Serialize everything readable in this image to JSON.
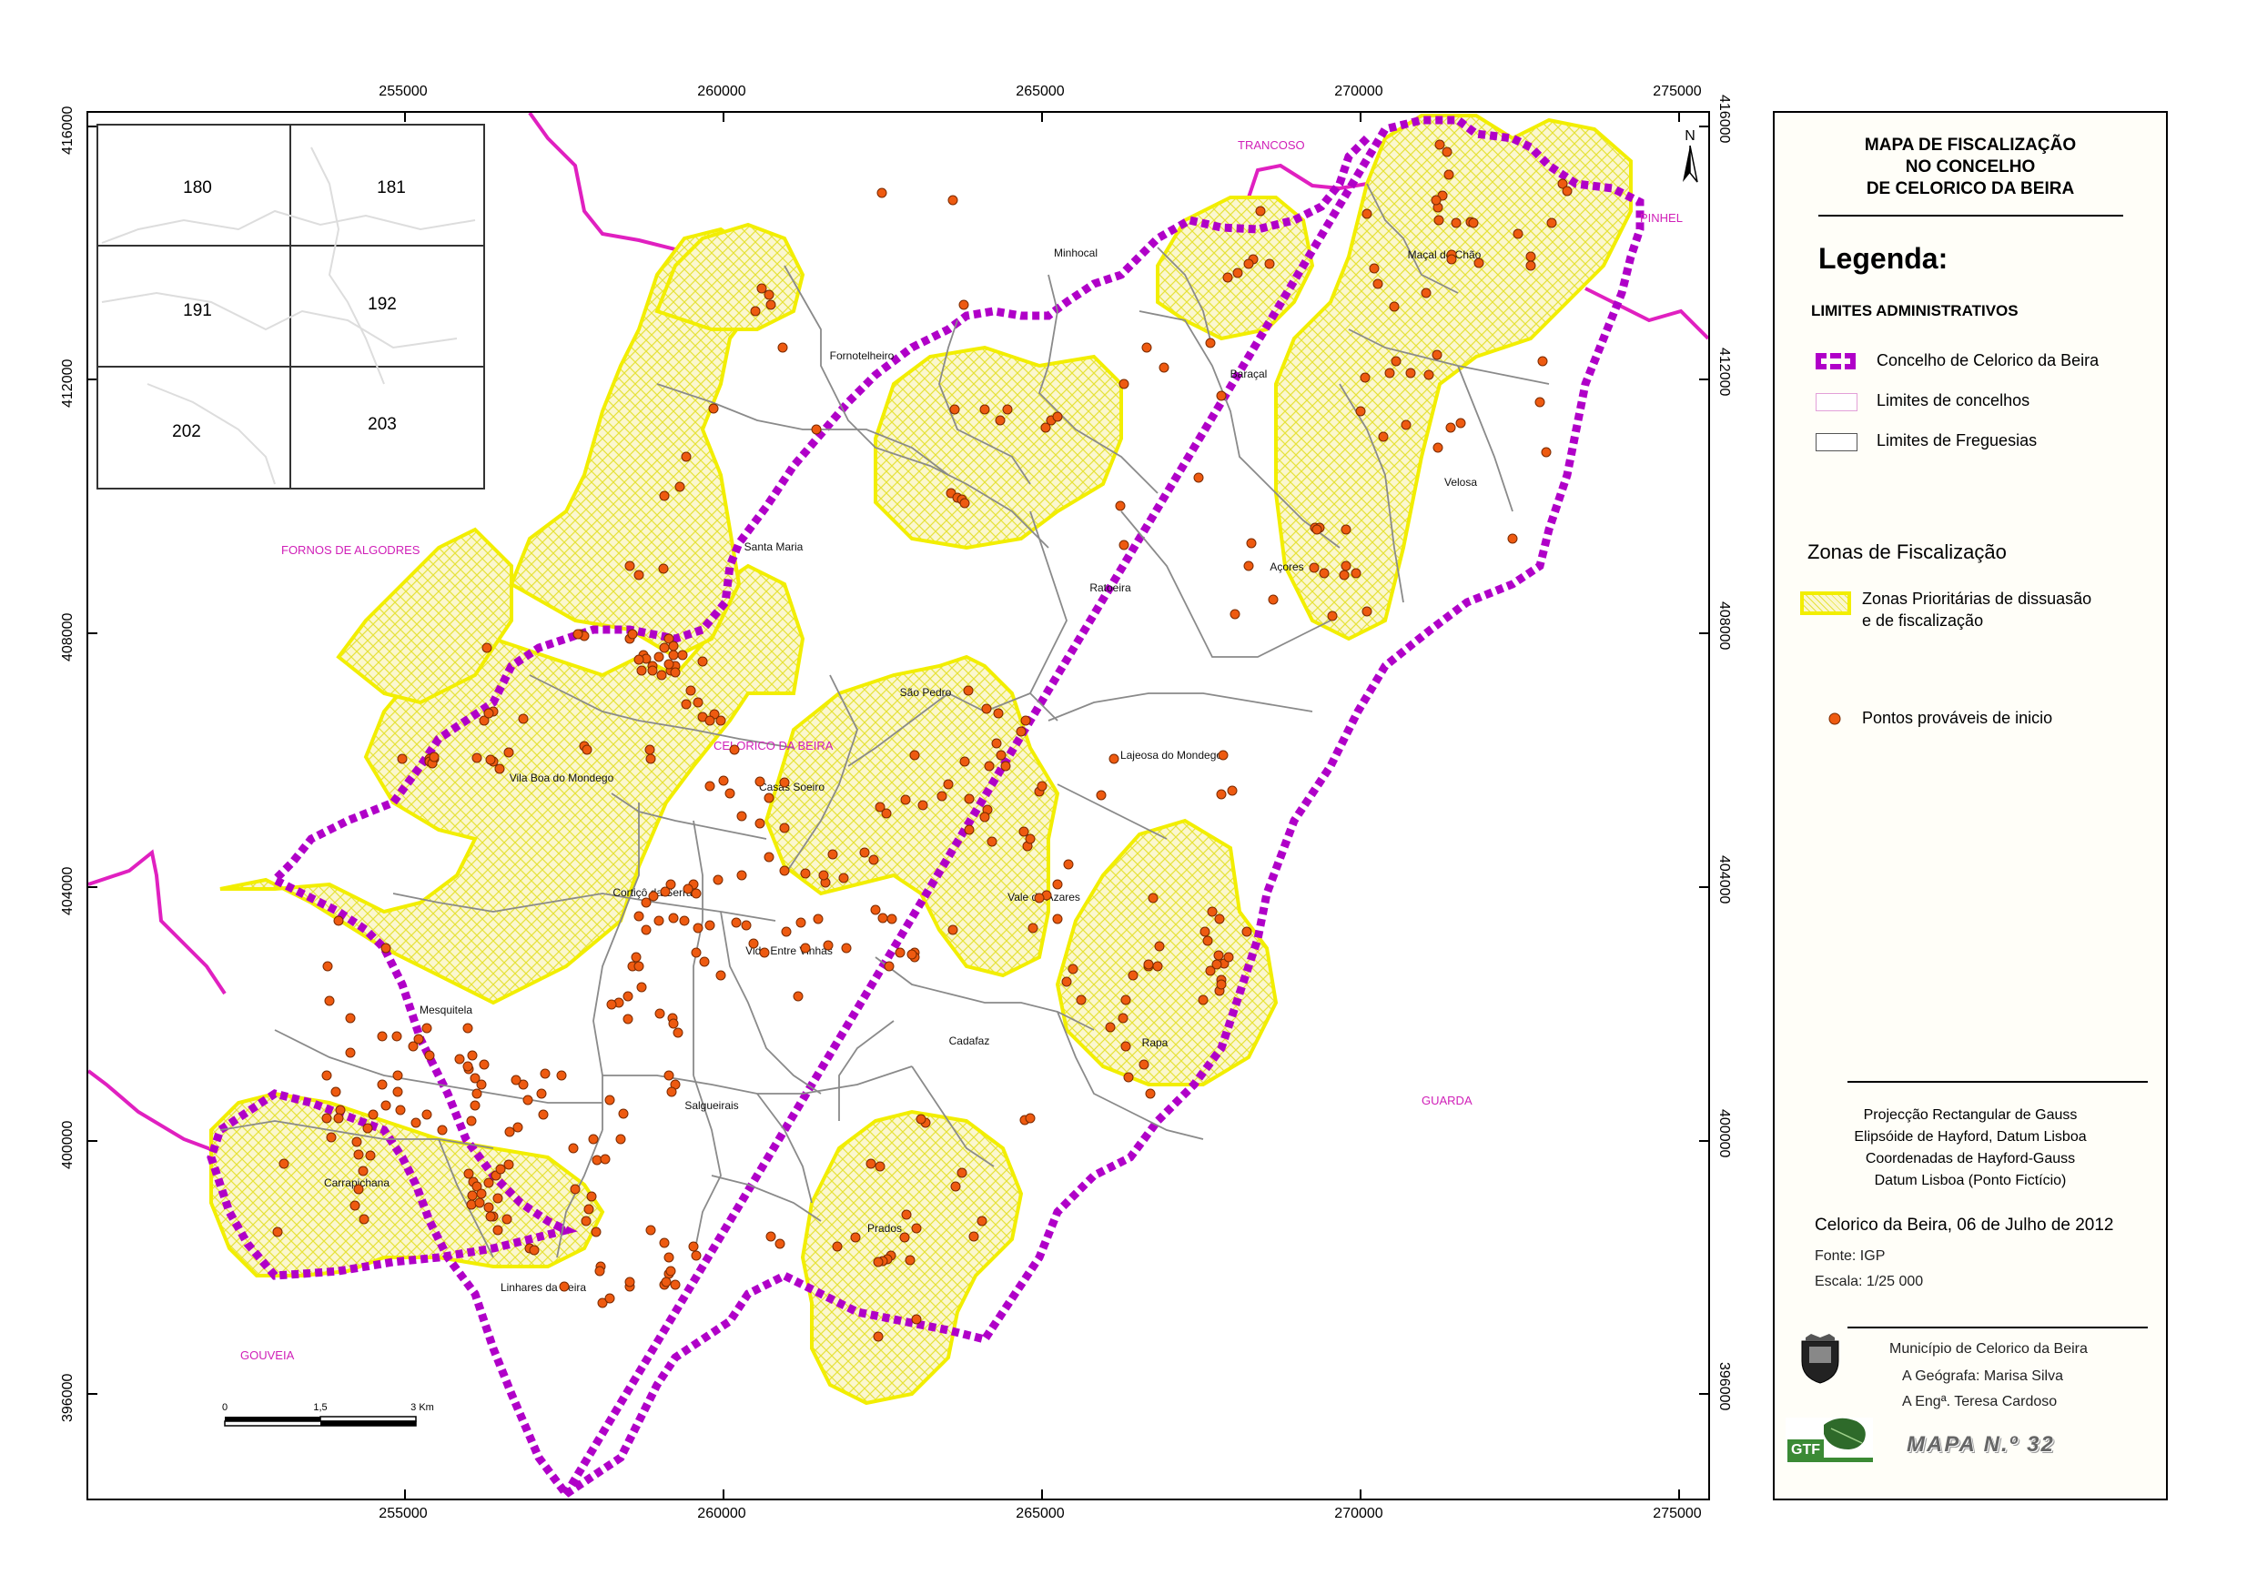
{
  "map": {
    "x_ticks": [
      "255000",
      "260000",
      "265000",
      "270000",
      "275000"
    ],
    "y_ticks": [
      "416000",
      "412000",
      "408000",
      "404000",
      "400000",
      "396000"
    ],
    "inset_sheets": [
      "180",
      "181",
      "191",
      "192",
      "202",
      "203"
    ],
    "neighbor_labels": {
      "trancoso": "TRANCOSO",
      "pinhel": "PINHEL",
      "fornos": "FORNOS DE ALGODRES",
      "celorico": "CELORICO DA BEIRA",
      "guarda": "GUARDA",
      "gouveia": "GOUVEIA"
    },
    "parishes": [
      "Minhocal",
      "Fornotelheiro",
      "Baraçal",
      "Maçal do Chão",
      "Velosa",
      "Açores",
      "Santa Maria",
      "Ratoeira",
      "São Pedro",
      "Lajeosa do Mondego",
      "Casas Soeiro",
      "Vila Boa do Mondego",
      "Cortiçô da Serra",
      "Vale de Azares",
      "Vide Entre Vinhas",
      "Mesquitela",
      "Rapa",
      "Cadafaz",
      "Salgueirais",
      "Carrapichana",
      "Prados",
      "Linhares da Beira"
    ],
    "north_label": "N",
    "scale_labels": [
      "0",
      "1,5",
      "3 Km"
    ],
    "colors": {
      "boundary": "#b000c8",
      "neighbor": "#e020c0",
      "zone": "#f2ee00",
      "zone_fill": "#fbf7cf",
      "point": "#ee5a10",
      "parish_lines": "#8a8a8a"
    }
  },
  "legend": {
    "title_lines": [
      "MAPA DE FISCALIZAÇÃO",
      "NO CONCELHO",
      "DE CELORICO DA BEIRA"
    ],
    "legenda": "Legenda:",
    "admin_heading": "LIMITES ADMINISTRATIVOS",
    "admin_items": [
      "Concelho de Celorico da Beira",
      "Limites de concelhos",
      "Limites de Freguesias"
    ],
    "zones_heading": "Zonas de Fiscalização",
    "zone_item_lines": [
      "Zonas Prioritárias de dissuasão",
      "e de fiscalização"
    ],
    "points_item": "Pontos prováveis de inicio",
    "projection_lines": [
      "Projecção Rectangular de Gauss",
      "Elipsóide de Hayford, Datum Lisboa",
      "Coordenadas de Hayford-Gauss",
      "Datum Lisboa (Ponto Fictício)"
    ],
    "date": "Celorico da Beira, 06 de Julho de 2012",
    "source": "Fonte: IGP",
    "scale": "Escala: 1/25 000",
    "credits": [
      "Município de Celorico da Beira",
      "A Geógrafa: Marisa Silva",
      "A Engª. Teresa Cardoso"
    ],
    "gtf_logo": "GTF",
    "mapa_number": "MAPA N.º 32"
  }
}
